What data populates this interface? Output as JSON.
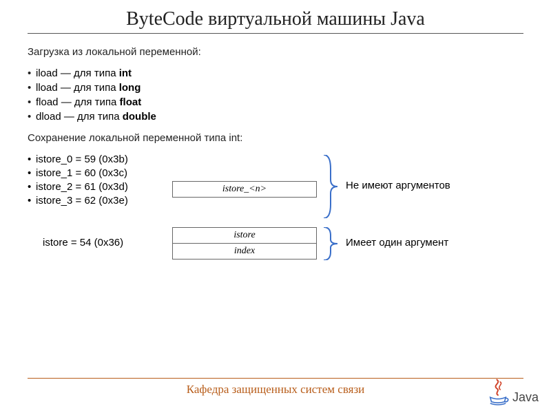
{
  "title": "ByteCode виртуальной машины Java",
  "section1_label": "Загрузка из локальной переменной:",
  "loads": [
    {
      "op": "iload",
      "text": "  — для типа ",
      "type": "int"
    },
    {
      "op": "lload",
      "text": " — для типа ",
      "type": "long"
    },
    {
      "op": "fload",
      "text": " — для типа ",
      "type": "float"
    },
    {
      "op": "dload",
      "text": " — для типа ",
      "type": "double"
    }
  ],
  "section2_label": "Сохранение локальной переменной типа int:",
  "istores": [
    "istore_0 = 59 (0x3b)",
    "istore_1 = 60 (0x3c)",
    "istore_2 = 61 (0x3d)",
    "istore_3 = 62 (0x3e)"
  ],
  "box_n_label": "istore_<n>",
  "note1": "Не имеют аргументов",
  "istore_single": "istore = 54 (0x36)",
  "box2_top": "istore",
  "box2_bottom": "index",
  "note2": "Имеет один аргумент",
  "footer_text": "Кафедра защищенных систем связи",
  "logo_word": "Java",
  "colors": {
    "accent": "#b85d1a",
    "bracket": "#3a6fc9"
  }
}
